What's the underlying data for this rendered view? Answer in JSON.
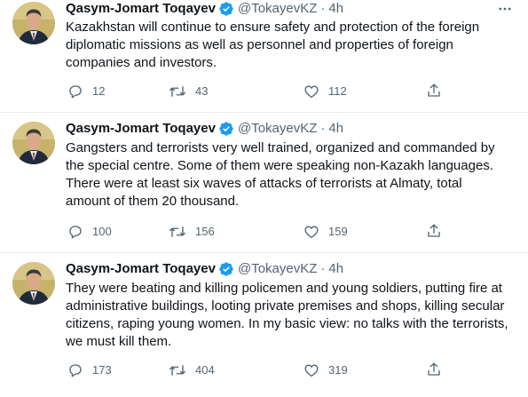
{
  "tweets": [
    {
      "display_name": "Qasym-Jomart Toqayev",
      "handle": "@TokayevKZ",
      "dot": "·",
      "time": "4h",
      "text": "Kazakhstan will continue to ensure safety and protection of the foreign\ndiplomatic missions as well as personnel and properties of foreign\ncompanies and investors.",
      "replies": "12",
      "retweets": "43",
      "likes": "112"
    },
    {
      "display_name": "Qasym-Jomart Toqayev",
      "handle": "@TokayevKZ",
      "dot": "·",
      "time": "4h",
      "text": "Gangsters and terrorists very well trained, organized and commanded by\nthe special centre. Some of them were speaking non-Kazakh languages.\nThere were at least six waves of attacks of terrorists at Almaty, total\namount of them 20 thousand.",
      "replies": "100",
      "retweets": "156",
      "likes": "159"
    },
    {
      "display_name": "Qasym-Jomart Toqayev",
      "handle": "@TokayevKZ",
      "dot": "·",
      "time": "4h",
      "text": "They were beating and killing policemen and young soldiers, putting fire at\nadministrative buildings, looting private premises and shops, killing secular\ncitizens, raping young women. In my basic view: no talks with the terrorists,\nwe must kill them.",
      "replies": "173",
      "retweets": "404",
      "likes": "319"
    }
  ],
  "colors": {
    "verified_badge": "#1d9bf0",
    "secondary_text": "#536471",
    "primary_text": "#0f1419",
    "divider": "#e6ecf0"
  },
  "icons": {
    "more": "more-dots-icon",
    "reply": "reply-icon",
    "retweet": "retweet-icon",
    "like": "like-icon",
    "share": "share-icon",
    "verified": "verified-badge-icon"
  }
}
